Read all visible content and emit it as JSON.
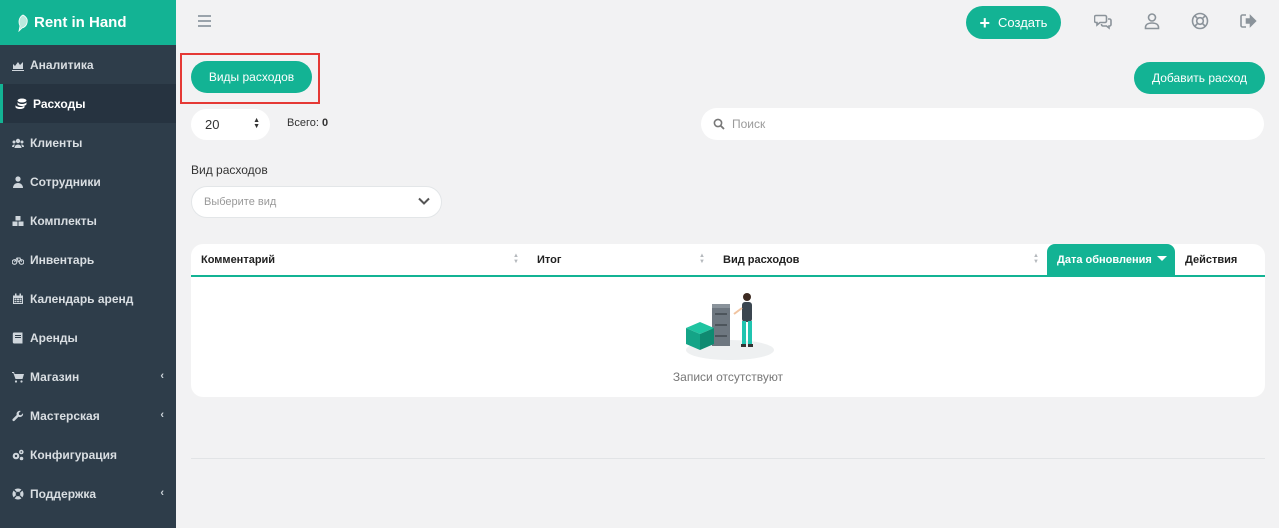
{
  "brand": {
    "name": "Rent in Hand"
  },
  "sidebar": {
    "items": [
      {
        "label": "Аналитика",
        "icon": "chart-icon",
        "active": false
      },
      {
        "label": "Расходы",
        "icon": "coins-icon",
        "active": true
      },
      {
        "label": "Клиенты",
        "icon": "users-icon",
        "active": false
      },
      {
        "label": "Сотрудники",
        "icon": "user-tie-icon",
        "active": false
      },
      {
        "label": "Комплекты",
        "icon": "boxes-icon",
        "active": false
      },
      {
        "label": "Инвентарь",
        "icon": "bicycle-icon",
        "active": false
      },
      {
        "label": "Календарь аренд",
        "icon": "calendar-icon",
        "active": false
      },
      {
        "label": "Аренды",
        "icon": "book-icon",
        "active": false
      },
      {
        "label": "Магазин",
        "icon": "cart-icon",
        "active": false,
        "expandable": true
      },
      {
        "label": "Мастерская",
        "icon": "wrench-icon",
        "active": false,
        "expandable": true
      },
      {
        "label": "Конфигурация",
        "icon": "cogs-icon",
        "active": false
      },
      {
        "label": "Поддержка",
        "icon": "lifebuoy-icon",
        "active": false,
        "expandable": true
      }
    ]
  },
  "topbar": {
    "create_label": "Создать",
    "icons": [
      "chat-icon",
      "user-icon",
      "support-icon",
      "logout-icon"
    ]
  },
  "toolbar": {
    "expense_types_label": "Виды расходов",
    "add_expense_label": "Добавить расход",
    "page_size": "20",
    "total_label": "Всего:",
    "total_value": "0",
    "search_placeholder": "Поиск"
  },
  "filter": {
    "label": "Вид расходов",
    "placeholder": "Выберите вид"
  },
  "table": {
    "columns": [
      "Комментарий",
      "Итог",
      "Вид расходов",
      "Дата обновления",
      "Действия"
    ],
    "sorted_column": "Дата обновления",
    "empty_text": "Записи отсутствуют"
  },
  "colors": {
    "accent": "#13b394",
    "sidebar": "#2e3d4a",
    "highlight": "#e53935"
  }
}
